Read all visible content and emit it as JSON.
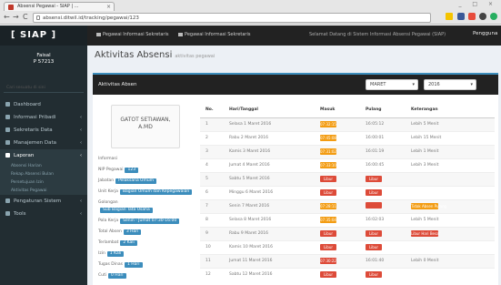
{
  "browser": {
    "tab_title": "Absensi Pegawai - SIAP | ...",
    "url": "absensi.ditwil.id/tracking/pegawai/123",
    "nav_glyphs": [
      "←",
      "→",
      "C"
    ],
    "win_glyphs": "_ □ ×"
  },
  "app": {
    "brand": "[ SIAP ]",
    "top_menu": [
      "Pegawai Informasi Sekretaris",
      "Pegawai Informasi Sekretaris"
    ],
    "top_right": "Selamat Datang di Sistem Informasi Absensi Pegawai (SIAP)",
    "user": "Pengguna"
  },
  "sidebar": {
    "profile_name": "Faisal",
    "profile_id": "P 57213",
    "search_placeholder": "Cari sesuatu di sini",
    "items": [
      {
        "label": "Dashboard",
        "caret": ""
      },
      {
        "label": "Informasi Pribadi",
        "caret": "‹"
      },
      {
        "label": "Sekretaris Data",
        "caret": "‹"
      },
      {
        "label": "Manajemen Data",
        "caret": "‹"
      },
      {
        "label": "Laporan",
        "caret": "‹"
      }
    ],
    "subitems": [
      "Absensi Harian",
      "Rekap Absensi Bulan",
      "Persetujuan Izin",
      "Aktivitas Pegawai"
    ],
    "items_after": [
      {
        "label": "Pengaturan Sistem",
        "caret": "‹"
      },
      {
        "label": "Tools",
        "caret": "‹"
      }
    ]
  },
  "page": {
    "title": "Aktivitas Absensi",
    "subtitle": "aktivitas pegawai"
  },
  "box": {
    "header": "Aktivitas Absen",
    "month_select": "MARET",
    "year_select": "2016"
  },
  "profile_card": {
    "name_line1": "GATOT SETIAWAN,",
    "name_line2": "A.MD"
  },
  "info_rows": [
    {
      "label": "Informasi",
      "chip": ""
    },
    {
      "label": "NIP Pegawai",
      "chip": "123"
    },
    {
      "label": "Jabatan",
      "chip": "Pelaksana Umum"
    },
    {
      "label": "Unit Kerja",
      "chip": "Bagian Umum dan Kepegawaian"
    },
    {
      "label": "Golongan",
      "chip": ""
    },
    {
      "label": "",
      "chip": "Sub Bagian Tata Usaha"
    },
    {
      "label": "Pola Kerja",
      "chip": "Senin - Jumat 07:30-16:00"
    },
    {
      "label": "Total Absen",
      "chip": "3 Hari"
    },
    {
      "label": "Terlambat",
      "chip": "2 Kali"
    },
    {
      "label": "Izin",
      "chip": "1 Kali"
    },
    {
      "label": "Tugas Dinas",
      "chip": "1 Hari"
    },
    {
      "label": "Cuti",
      "chip": "0 Hari"
    }
  ],
  "table": {
    "headers": [
      "No.",
      "Hari/Tanggal",
      "Masuk",
      "Pulang",
      "Keterangan"
    ],
    "rows": [
      {
        "no": "1",
        "date": "Selasa 1 Maret 2016",
        "in": "07:32:15",
        "in_color": "#f39c12",
        "out": "16:05:12",
        "out_color": "",
        "note": "Lebih 5 Menit",
        "note_color": ""
      },
      {
        "no": "2",
        "date": "Rabu 2 Maret 2016",
        "in": "07:45:08",
        "in_color": "#f39c12",
        "out": "16:00:01",
        "out_color": "",
        "note": "Lebih 15 Menit",
        "note_color": ""
      },
      {
        "no": "3",
        "date": "Kamis 3 Maret 2016",
        "in": "07:31:02",
        "in_color": "#f39c12",
        "out": "16:01:19",
        "out_color": "",
        "note": "Lebih 1 Menit",
        "note_color": ""
      },
      {
        "no": "4",
        "date": "Jumat 4 Maret 2016",
        "in": "07:33:10",
        "in_color": "#f39c12",
        "out": "16:00:45",
        "out_color": "",
        "note": "Lebih 3 Menit",
        "note_color": ""
      },
      {
        "no": "5",
        "date": "Sabtu 5 Maret 2016",
        "in": "Libur",
        "in_color": "#dd4b39",
        "out": "Libur",
        "out_color": "#dd4b39",
        "note": "",
        "note_color": ""
      },
      {
        "no": "6",
        "date": "Minggu 6 Maret 2016",
        "in": "Libur",
        "in_color": "#dd4b39",
        "out": "Libur",
        "out_color": "#dd4b39",
        "note": "",
        "note_color": ""
      },
      {
        "no": "7",
        "date": "Senin 7 Maret 2016",
        "in": "07:28:11",
        "in_color": "#f39c12",
        "out": "",
        "out_color": "#dd4b39",
        "note": "Tidak Absen Pulang",
        "note_color": "#f39c12"
      },
      {
        "no": "8",
        "date": "Selasa 8 Maret 2016",
        "in": "07:35:04",
        "in_color": "#f39c12",
        "out": "16:02:03",
        "out_color": "",
        "note": "Lebih 5 Menit",
        "note_color": ""
      },
      {
        "no": "9",
        "date": "Rabu 9 Maret 2016",
        "in": "Libur",
        "in_color": "#dd4b39",
        "out": "Libur",
        "out_color": "#dd4b39",
        "note": "Libur Hari Besar",
        "note_color": "#dd4b39"
      },
      {
        "no": "10",
        "date": "Kamis 10 Maret 2016",
        "in": "Libur",
        "in_color": "#dd4b39",
        "out": "Libur",
        "out_color": "#dd4b39",
        "note": "",
        "note_color": ""
      },
      {
        "no": "11",
        "date": "Jumat 11 Maret 2016",
        "in": "07:30:22",
        "in_color": "#dd4b39",
        "out": "16:01:40",
        "out_color": "",
        "note": "Lebih 0 Menit",
        "note_color": ""
      },
      {
        "no": "12",
        "date": "Sabtu 12 Maret 2016",
        "in": "Libur",
        "in_color": "#dd4b39",
        "out": "Libur",
        "out_color": "#dd4b39",
        "note": "",
        "note_color": ""
      }
    ]
  },
  "colors": {
    "accent": "#3c8dbc",
    "warning": "#f39c12",
    "danger": "#dd4b39",
    "sidebar": "#222d32",
    "topbar": "#222222"
  }
}
